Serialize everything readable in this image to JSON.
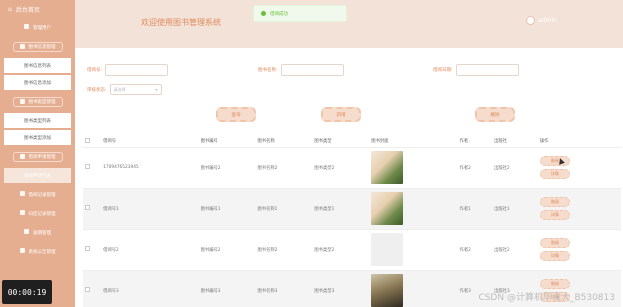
{
  "sidebar": {
    "header_label": "后台首页",
    "items": [
      {
        "type": "cat",
        "label": "管理用户"
      },
      {
        "type": "cat",
        "label": "图书信息管理",
        "hl": true
      },
      {
        "type": "sub",
        "label": "图书信息列表"
      },
      {
        "type": "sub",
        "label": "图书信息添加"
      },
      {
        "type": "cat",
        "label": "图书类型管理",
        "hl": true
      },
      {
        "type": "sub",
        "label": "图书类型列表"
      },
      {
        "type": "sub",
        "label": "图书类型添加"
      },
      {
        "type": "cat",
        "label": "借阅申请管理",
        "hl": true
      },
      {
        "type": "sub",
        "label": "借阅申请列表",
        "active": true
      },
      {
        "type": "cat",
        "label": "借阅记录管理"
      },
      {
        "type": "cat",
        "label": "归还记录管理"
      },
      {
        "type": "cat",
        "label": "逾期管理"
      },
      {
        "type": "cat",
        "label": "系统公告管理"
      }
    ]
  },
  "topbar": {
    "title": "欢迎使用图书管理系统",
    "user": "admin"
  },
  "toast": {
    "text": "借阅成功"
  },
  "search": {
    "field1_label": "借阅号:",
    "field2_label": "图书名称:",
    "field3_label": "借阅日期:",
    "field4_label": "审核状态:",
    "field4_value": "请选择",
    "search_btn": "查询",
    "add_btn": "新增",
    "delete_btn": "删除"
  },
  "table": {
    "headers": [
      "",
      "借阅号",
      "图书编号",
      "图书名称",
      "图书类型",
      "图书封面",
      "作者",
      "出版社",
      "操作"
    ],
    "rows": [
      {
        "no": "1709476523945",
        "code": "图书编号2",
        "name": "图书名称2",
        "type": "图书类型2",
        "thumb": "book",
        "author": "作者2",
        "publisher": "出版社2",
        "ops": [
          "借阅",
          "详情"
        ]
      },
      {
        "no": "借阅号1",
        "code": "图书编号1",
        "name": "图书名称1",
        "type": "图书类型1",
        "thumb": "book",
        "author": "作者1",
        "publisher": "出版社1",
        "ops": [
          "借阅",
          "详情"
        ]
      },
      {
        "no": "借阅号2",
        "code": "图书编号2",
        "name": "图书名称2",
        "type": "图书类型2",
        "thumb": "gray",
        "author": "作者2",
        "publisher": "出版社2",
        "ops": [
          "借阅",
          "详情"
        ]
      },
      {
        "no": "借阅号3",
        "code": "图书编号3",
        "name": "图书名称3",
        "type": "图书类型3",
        "thumb": "dark",
        "author": "作者3",
        "publisher": "出版社3",
        "ops": [
          "借阅",
          "详情"
        ]
      }
    ]
  },
  "overlay": {
    "timer": "00:00:19",
    "watermark": "CSDN @计算机毕设大_B530813"
  }
}
